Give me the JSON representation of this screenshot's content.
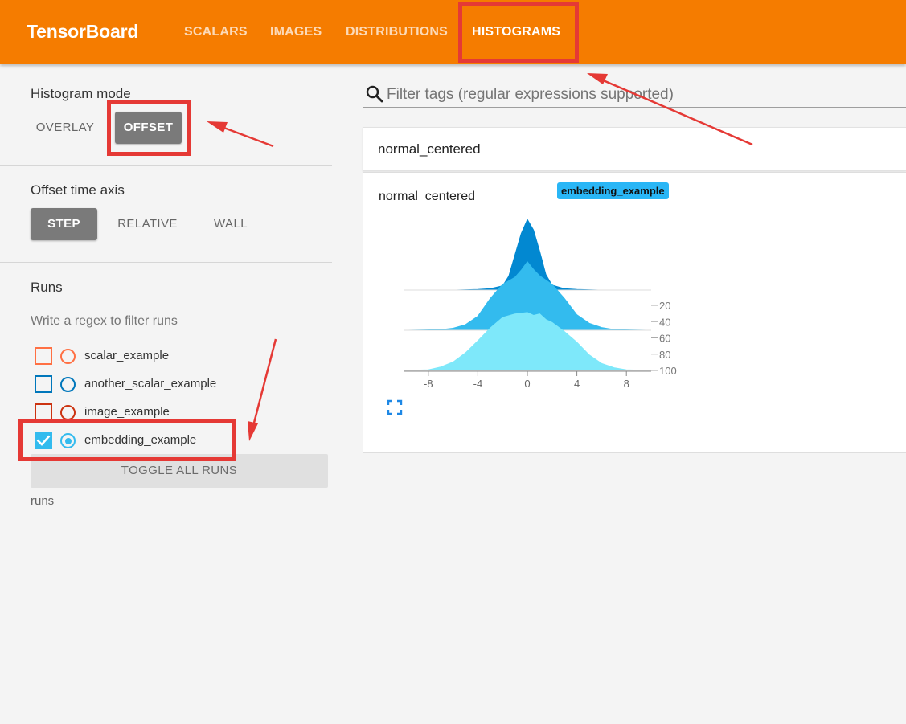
{
  "app": {
    "title": "TensorBoard"
  },
  "nav": {
    "tabs": [
      {
        "label": "SCALARS",
        "active": false
      },
      {
        "label": "IMAGES",
        "active": false
      },
      {
        "label": "DISTRIBUTIONS",
        "active": false
      },
      {
        "label": "HISTOGRAMS",
        "active": true
      }
    ]
  },
  "sidebar": {
    "histogram_mode": {
      "title": "Histogram mode",
      "options": [
        "OVERLAY",
        "OFFSET"
      ],
      "selected": "OFFSET"
    },
    "offset_time_axis": {
      "title": "Offset time axis",
      "options": [
        "STEP",
        "RELATIVE",
        "WALL"
      ],
      "selected": "STEP"
    },
    "runs": {
      "title": "Runs",
      "filter_placeholder": "Write a regex to filter runs",
      "items": [
        {
          "name": "scalar_example",
          "color": "#ff7043",
          "checked": false,
          "selected": false
        },
        {
          "name": "another_scalar_example",
          "color": "#0077bb",
          "checked": false,
          "selected": false
        },
        {
          "name": "image_example",
          "color": "#cc3311",
          "checked": false,
          "selected": false
        },
        {
          "name": "embedding_example",
          "color": "#33bbee",
          "checked": true,
          "selected": true
        }
      ],
      "toggle_label": "TOGGLE ALL RUNS",
      "footer": "runs"
    }
  },
  "main": {
    "search_placeholder": "Filter tags (regular expressions supported)",
    "pane_title": "normal_centered",
    "card": {
      "title": "normal_centered",
      "run_chip": "embedding_example",
      "run_chip_color": "#29b6f6"
    }
  },
  "chart_data": {
    "type": "area",
    "mode": "offset",
    "x_ticks": [
      -8,
      -4,
      0,
      4,
      8
    ],
    "xlim": [
      -10,
      10
    ],
    "y_ticks": [
      20,
      40,
      60,
      80,
      100
    ],
    "ylabel": "",
    "xlabel": "",
    "series": [
      {
        "step": 0,
        "color": "#0288d1",
        "x": [
          -10,
          -6,
          -4,
          -3,
          -2,
          -1.5,
          -1,
          -0.5,
          0,
          0.5,
          1,
          1.5,
          2,
          3,
          4,
          6,
          10
        ],
        "y": [
          0,
          0,
          0.01,
          0.02,
          0.06,
          0.2,
          0.5,
          0.8,
          1.0,
          0.85,
          0.55,
          0.22,
          0.07,
          0.02,
          0.01,
          0,
          0
        ]
      },
      {
        "step": 50,
        "color": "#33bbee",
        "x": [
          -10,
          -7,
          -6,
          -5,
          -4,
          -3,
          -2,
          -1,
          -0.5,
          0,
          0.5,
          1,
          2,
          3,
          4,
          5,
          6,
          7,
          10
        ],
        "y": [
          0,
          0.01,
          0.03,
          0.08,
          0.2,
          0.45,
          0.65,
          0.75,
          0.85,
          0.97,
          0.86,
          0.77,
          0.65,
          0.45,
          0.22,
          0.1,
          0.04,
          0.01,
          0
        ]
      },
      {
        "step": 100,
        "color": "#7ee8fa",
        "x": [
          -10,
          -8,
          -7,
          -6,
          -5,
          -4,
          -3,
          -2,
          -1,
          0,
          0.5,
          1,
          1.5,
          2,
          3,
          4,
          5,
          6,
          7,
          8,
          10
        ],
        "y": [
          0,
          0.01,
          0.05,
          0.12,
          0.25,
          0.42,
          0.6,
          0.75,
          0.8,
          0.82,
          0.78,
          0.8,
          0.72,
          0.68,
          0.55,
          0.4,
          0.22,
          0.1,
          0.04,
          0.01,
          0
        ]
      }
    ]
  }
}
